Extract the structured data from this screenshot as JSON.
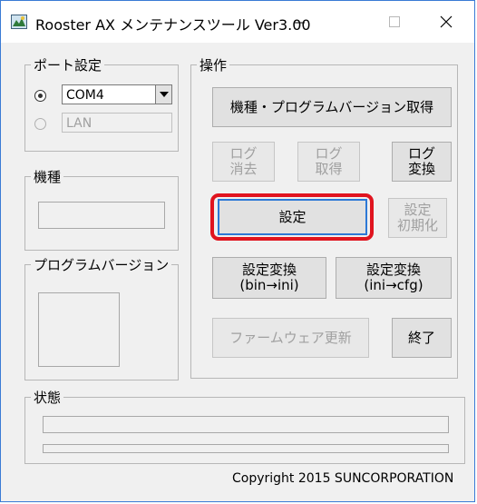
{
  "window": {
    "title": "Rooster AX メンテナンスツール Ver3.00",
    "icon": "app-icon",
    "controls": {
      "minimize": "minimize-icon",
      "maximize": "maximize-icon",
      "close": "close-icon"
    }
  },
  "port_group": {
    "title": "ポート設定",
    "com_selected": true,
    "com_value": "COM4",
    "lan_value": "LAN"
  },
  "model_group": {
    "title": "機種",
    "value": ""
  },
  "program_group": {
    "title": "プログラムバージョン",
    "value": ""
  },
  "operation_group": {
    "title": "操作",
    "buttons": {
      "get_version": "機種・プログラムバージョン取得",
      "log_clear": "ログ\n消去",
      "log_get": "ログ\n取得",
      "log_convert": "ログ\n変換",
      "settings": "設定",
      "settings_init": "設定\n初期化",
      "convert_bin_ini": "設定変換\n(bin→ini)",
      "convert_ini_cfg": "設定変換\n(ini→cfg)",
      "firmware_update": "ファームウェア更新",
      "exit": "終了"
    }
  },
  "status_group": {
    "title": "状態"
  },
  "copyright": "Copyright 2015 SUNCORPORATION",
  "colors": {
    "highlight": "#e0141f",
    "window_border": "#3a7bd5"
  }
}
